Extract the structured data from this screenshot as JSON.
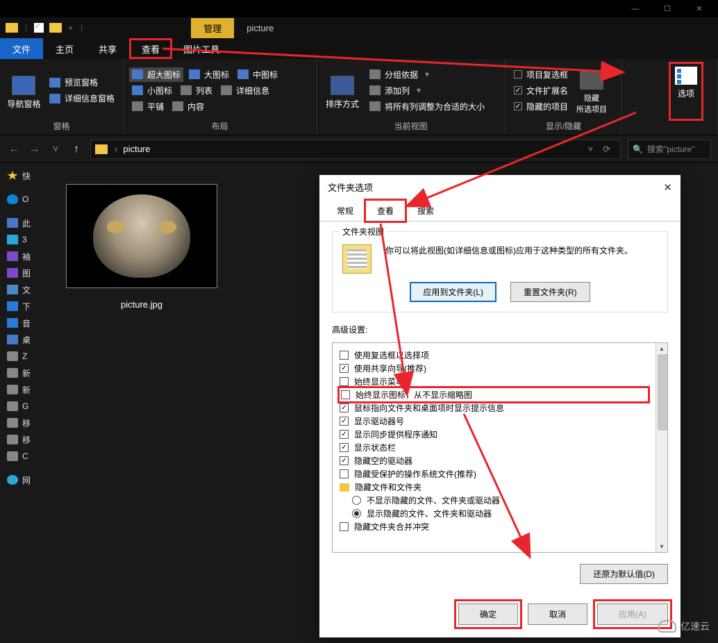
{
  "window": {
    "minimize": "—",
    "maximize": "☐",
    "close": "✕"
  },
  "qat": {
    "manage": "管理",
    "location": "picture"
  },
  "tabs": {
    "file": "文件",
    "home": "主页",
    "share": "共享",
    "view": "查看",
    "pictools": "图片工具"
  },
  "ribbon": {
    "panes": {
      "nav": "导航窗格",
      "preview": "预览窗格",
      "details": "详细信息窗格",
      "group": "窗格"
    },
    "layout": {
      "xl": "超大图标",
      "l": "大图标",
      "m": "中图标",
      "s": "小图标",
      "list": "列表",
      "details": "详细信息",
      "tiles": "平铺",
      "content": "内容",
      "group": "布局"
    },
    "curview": {
      "sort": "排序方式",
      "groupby": "分组依据",
      "addcol": "添加列",
      "autosize": "将所有列调整为合适的大小",
      "group": "当前视图"
    },
    "showhide": {
      "itemcb": "项目复选框",
      "ext": "文件扩展名",
      "hidden": "隐藏的项目",
      "hidesel": "隐藏\n所选项目",
      "group": "显示/隐藏"
    },
    "options": {
      "label": "选项"
    }
  },
  "addr": {
    "path": "picture",
    "search_ph": "搜索\"picture\""
  },
  "tree": {
    "quick": "快",
    "onedrive": "O",
    "thispc": "此",
    "obj3d": "3",
    "videos": "袖",
    "pics": "图",
    "docs": "文",
    "downloads": "下",
    "music": "音",
    "desktop": "桌",
    "z": "Z",
    "x1": "新",
    "x2": "新",
    "g": "G",
    "r1": "移",
    "r2": "移",
    "c": "C",
    "net": "网"
  },
  "file": {
    "name": "picture.jpg"
  },
  "dialog": {
    "title": "文件夹选项",
    "tabs": {
      "general": "常规",
      "view": "查看",
      "search": "搜索"
    },
    "fv": {
      "legend": "文件夹视图",
      "text": "你可以将此视图(如详细信息或图标)应用于这种类型的所有文件夹。",
      "apply": "应用到文件夹(L)",
      "reset": "重置文件夹(R)"
    },
    "adv_label": "高级设置:",
    "opts": {
      "usecb": "使用复选框以选择项",
      "sharewiz": "使用共享向导(推荐)",
      "always_menu": "始终显示菜单",
      "always_icon": "始终显示图标，从不显示缩略图",
      "hover_tip": "鼠标指向文件夹和桌面项时显示提示信息",
      "drive_letter": "显示驱动器号",
      "sync_notify": "显示同步提供程序通知",
      "statusbar": "显示状态栏",
      "hide_empty_drv": "隐藏空的驱动器",
      "hide_protected": "隐藏受保护的操作系统文件(推荐)",
      "hidden_folder": "隐藏文件和文件夹",
      "no_show_hidden": "不显示隐藏的文件、文件夹或驱动器",
      "show_hidden": "显示隐藏的文件、文件夹和驱动器",
      "merge_conflict": "隐藏文件夹合并冲突"
    },
    "restore": "还原为默认值(D)",
    "ok": "确定",
    "cancel": "取消",
    "apply": "应用(A)"
  },
  "watermark": "亿速云"
}
